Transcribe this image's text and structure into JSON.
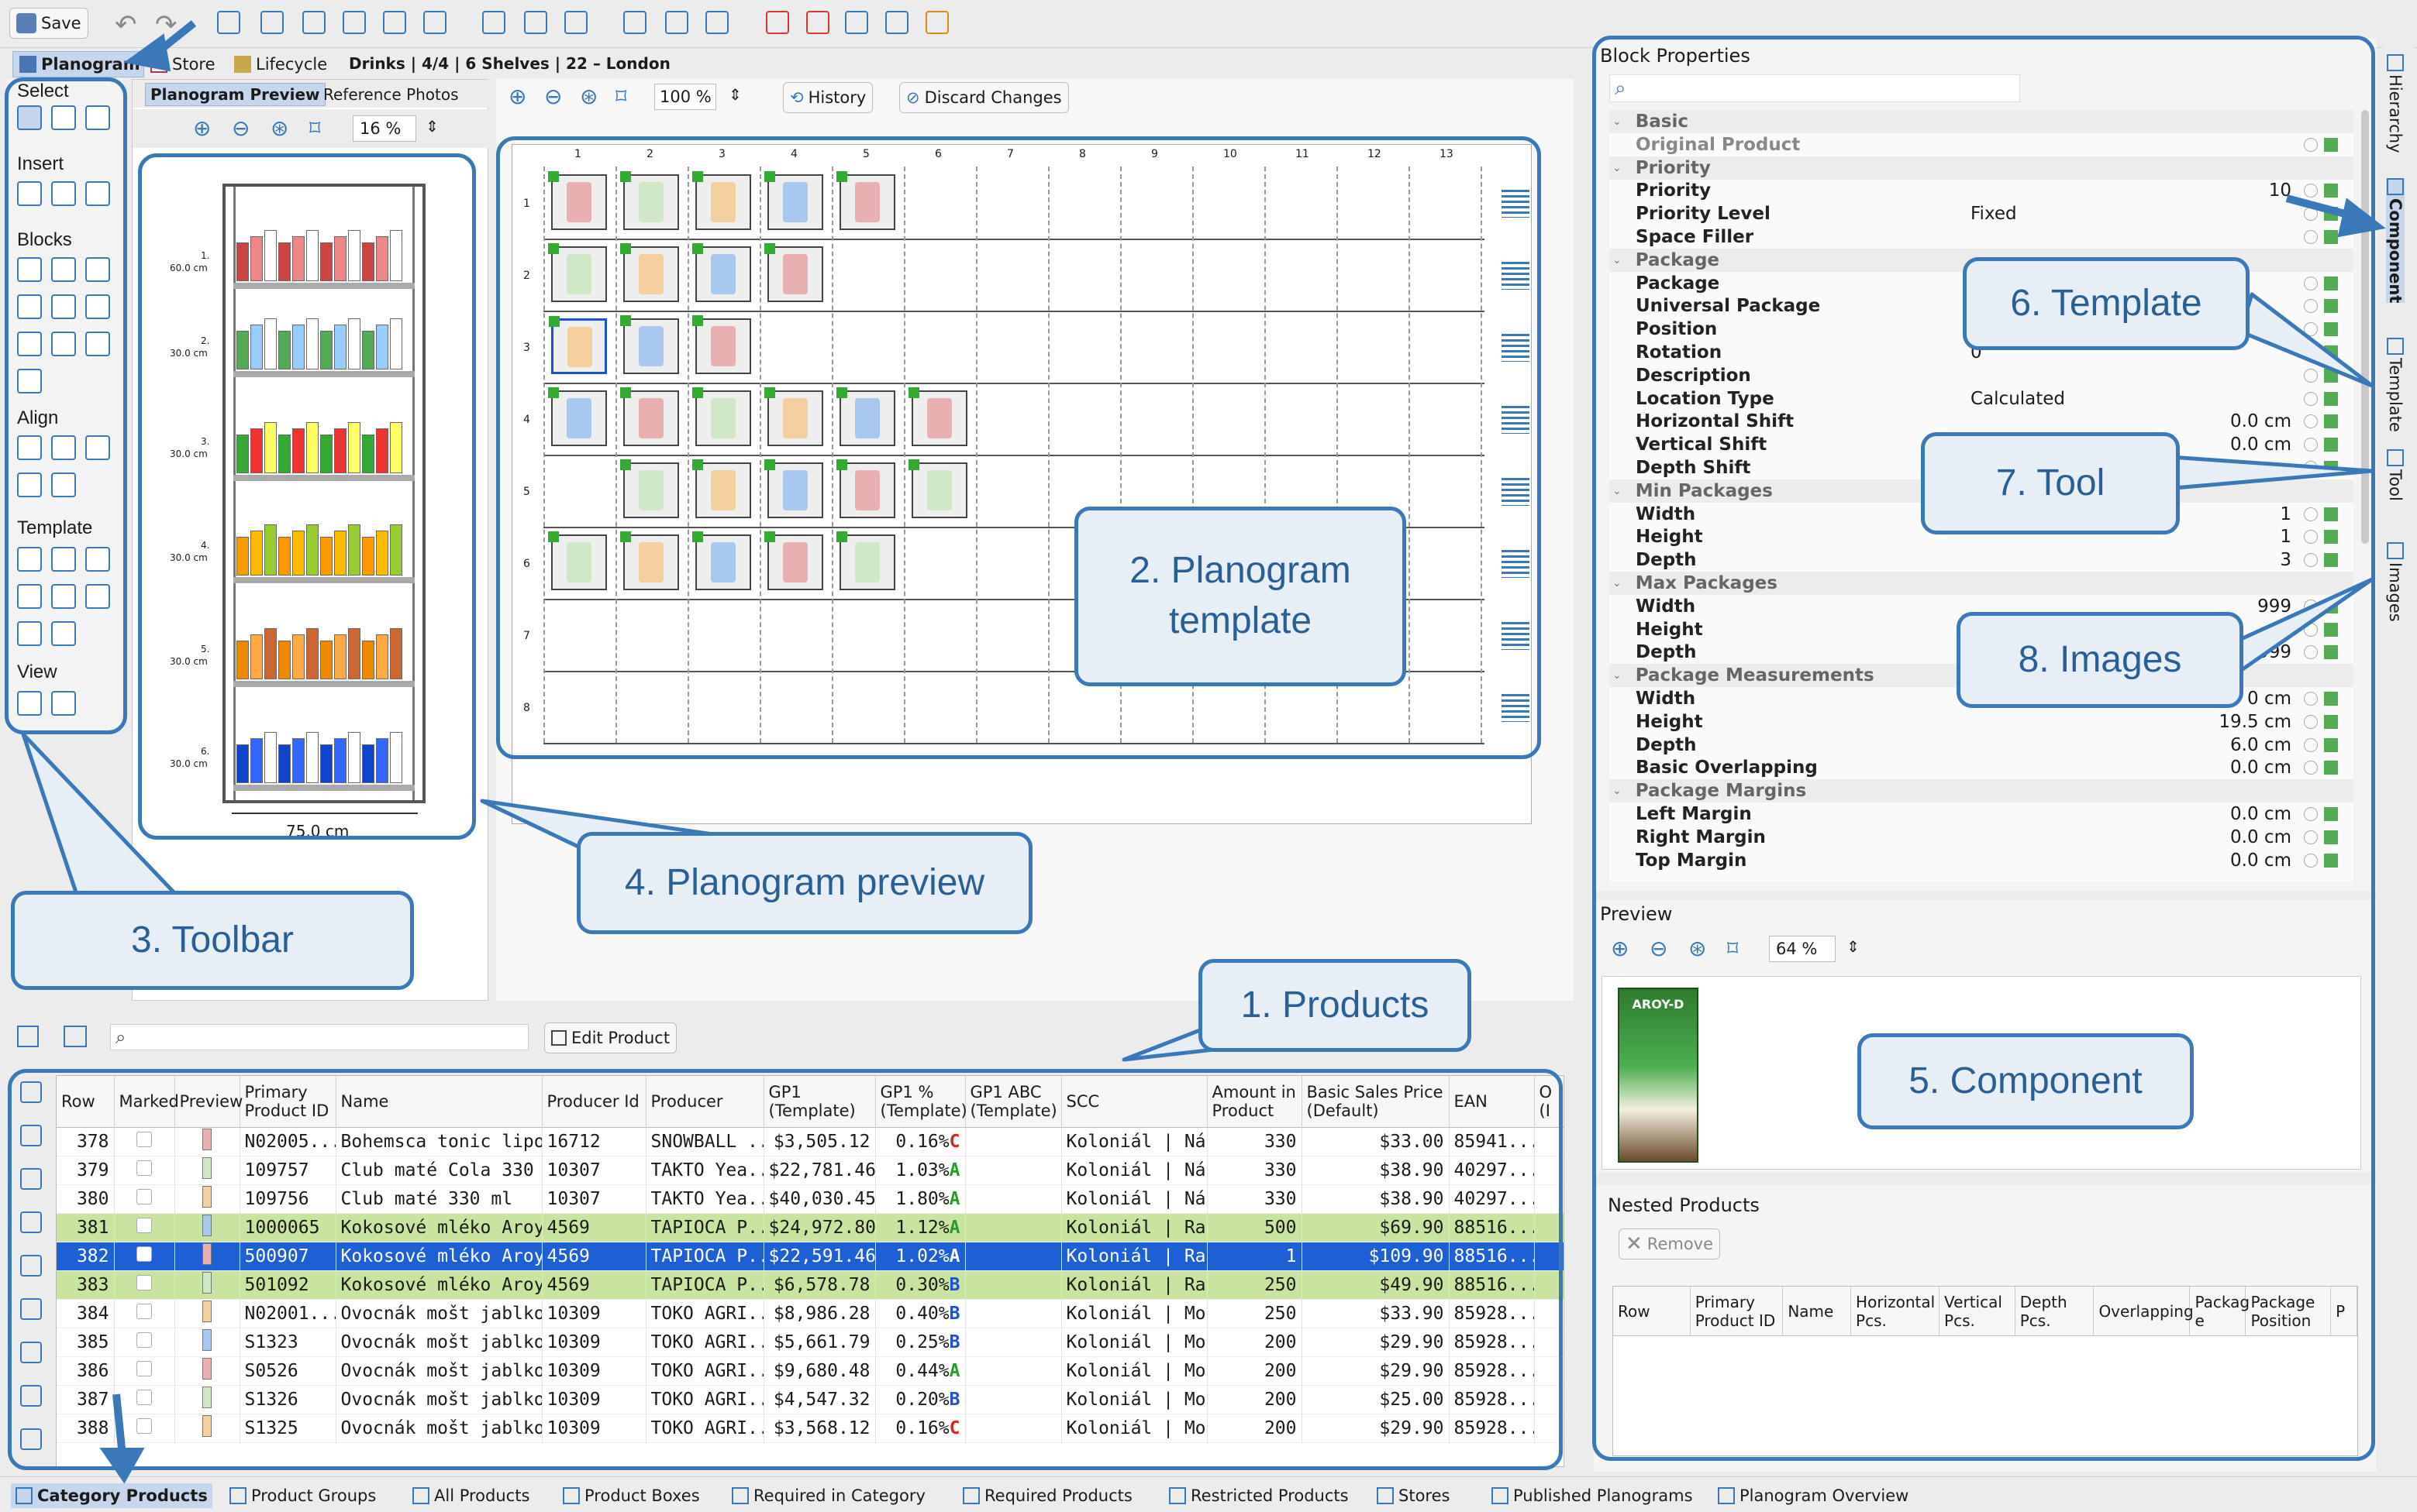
{
  "toolbar": {
    "save_label": "Save"
  },
  "tabs": {
    "planogram": "Planogram",
    "store": "Store",
    "lifecycle": "Lifecycle",
    "breadcrumb": "Drinks | 4/4 | 6 Shelves | 22 – London"
  },
  "left_toolbar": {
    "select": "Select",
    "insert": "Insert",
    "blocks": "Blocks",
    "align": "Align",
    "template": "Template",
    "view": "View"
  },
  "preview_panel": {
    "tab_active": "Planogram Preview",
    "tab_other": "Reference Photos",
    "zoom": "16 %",
    "width_label": "75.0 cm",
    "shelf_labels": [
      {
        "n": "1.",
        "h": "60.0 cm"
      },
      {
        "n": "2.",
        "h": "30.0 cm"
      },
      {
        "n": "3.",
        "h": "30.0 cm"
      },
      {
        "n": "4.",
        "h": "30.0 cm"
      },
      {
        "n": "5.",
        "h": "30.0 cm"
      },
      {
        "n": "6.",
        "h": "30.0 cm"
      }
    ]
  },
  "template_panel": {
    "zoom": "100 %",
    "history": "History",
    "discard": "Discard Changes",
    "col_numbers": [
      "1",
      "2",
      "3",
      "4",
      "5",
      "6",
      "7",
      "8",
      "9",
      "10",
      "11",
      "12",
      "13"
    ],
    "row_numbers": [
      "1",
      "2",
      "3",
      "4",
      "5",
      "6",
      "7",
      "8"
    ]
  },
  "products_panel": {
    "edit_product": "Edit Product",
    "columns": [
      "Row",
      "Marked",
      "Preview",
      "Primary Product ID",
      "Name",
      "Producer Id",
      "Producer",
      "GP1 (Template)",
      "GP1 % (Template)",
      "GP1 ABC (Template)",
      "SCC",
      "Amount in Product",
      "Basic Sales Price (Default)",
      "EAN",
      "O (I"
    ],
    "sort_indicator": "1",
    "rows": [
      {
        "row": "378",
        "id": "N02005...",
        "name": "Bohemsca tonic lipový...",
        "pid": "16712",
        "producer": "SNOWBALL ...",
        "gp1": "$3,505.12",
        "gp1p": "0.16%",
        "abc": "C",
        "scc": "Koloniál | Náp...",
        "amount": "330",
        "price": "$33.00",
        "ean": "85941...",
        "style": "normal"
      },
      {
        "row": "379",
        "id": "109757",
        "name": "Club maté Cola 330 ml",
        "pid": "10307",
        "producer": "TAKTO Yea...",
        "gp1": "$22,781.46",
        "gp1p": "1.03%",
        "abc": "A",
        "scc": "Koloniál | Náp...",
        "amount": "330",
        "price": "$38.90",
        "ean": "40297...",
        "style": "normal"
      },
      {
        "row": "380",
        "id": "109756",
        "name": "Club maté 330 ml",
        "pid": "10307",
        "producer": "TAKTO Yea...",
        "gp1": "$40,030.45",
        "gp1p": "1.80%",
        "abc": "A",
        "scc": "Koloniál | Náp...",
        "amount": "330",
        "price": "$38.90",
        "ean": "40297...",
        "style": "normal"
      },
      {
        "row": "381",
        "id": "1000065",
        "name": "Kokosové mléko Aroy...",
        "pid": "4569",
        "producer": "TAPIOCA P...",
        "gp1": "$24,972.80",
        "gp1p": "1.12%",
        "abc": "A",
        "scc": "Koloniál | Raci...",
        "amount": "500",
        "price": "$69.90",
        "ean": "88516...",
        "style": "green"
      },
      {
        "row": "382",
        "id": "500907",
        "name": "Kokosové mléko Aroy...",
        "pid": "4569",
        "producer": "TAPIOCA P...",
        "gp1": "$22,591.46",
        "gp1p": "1.02%",
        "abc": "A",
        "scc": "Koloniál | Raci...",
        "amount": "1",
        "price": "$109.90",
        "ean": "88516...",
        "style": "selected"
      },
      {
        "row": "383",
        "id": "501092",
        "name": "Kokosové mléko Aroy...",
        "pid": "4569",
        "producer": "TAPIOCA P...",
        "gp1": "$6,578.78",
        "gp1p": "0.30%",
        "abc": "B",
        "scc": "Koloniál | Raci...",
        "amount": "250",
        "price": "$49.90",
        "ean": "88516...",
        "style": "green"
      },
      {
        "row": "384",
        "id": "N02001...",
        "name": "Ovocnák mošt jablko ...",
        "pid": "10309",
        "producer": "TOKO AGRI...",
        "gp1": "$8,986.28",
        "gp1p": "0.40%",
        "abc": "B",
        "scc": "Koloniál | Moš...",
        "amount": "250",
        "price": "$33.90",
        "ean": "85928...",
        "style": "normal"
      },
      {
        "row": "385",
        "id": "S1323",
        "name": "Ovocnák mošt jablko...",
        "pid": "10309",
        "producer": "TOKO AGRI...",
        "gp1": "$5,661.79",
        "gp1p": "0.25%",
        "abc": "B",
        "scc": "Koloniál | Moš...",
        "amount": "200",
        "price": "$29.90",
        "ean": "85928...",
        "style": "normal"
      },
      {
        "row": "386",
        "id": "S0526",
        "name": "Ovocnák mošt jablko...",
        "pid": "10309",
        "producer": "TOKO AGRI...",
        "gp1": "$9,680.48",
        "gp1p": "0.44%",
        "abc": "A",
        "scc": "Koloniál | Moš...",
        "amount": "200",
        "price": "$29.90",
        "ean": "85928...",
        "style": "normal"
      },
      {
        "row": "387",
        "id": "S1326",
        "name": "Ovocnák mošt jablko...",
        "pid": "10309",
        "producer": "TOKO AGRI...",
        "gp1": "$4,547.32",
        "gp1p": "0.20%",
        "abc": "B",
        "scc": "Koloniál | Moš...",
        "amount": "200",
        "price": "$25.00",
        "ean": "85928...",
        "style": "normal"
      },
      {
        "row": "388",
        "id": "S1325",
        "name": "Ovocnák mošt jablko...",
        "pid": "10309",
        "producer": "TOKO AGRI...",
        "gp1": "$3,568.12",
        "gp1p": "0.16%",
        "abc": "C",
        "scc": "Koloniál | Moš...",
        "amount": "200",
        "price": "$29.90",
        "ean": "85928...",
        "style": "normal"
      }
    ]
  },
  "block_properties": {
    "title": "Block Properties",
    "rows": [
      {
        "kind": "group",
        "name": "Basic"
      },
      {
        "kind": "prop",
        "name": "Original Product",
        "muted": true,
        "value": ""
      },
      {
        "kind": "group",
        "name": "Priority"
      },
      {
        "kind": "prop",
        "name": "Priority",
        "value": "10",
        "align": "right"
      },
      {
        "kind": "prop",
        "name": "Priority Level",
        "value": "Fixed"
      },
      {
        "kind": "prop",
        "name": "Space Filler",
        "value": ""
      },
      {
        "kind": "group",
        "name": "Package"
      },
      {
        "kind": "prop",
        "name": "Package",
        "value": ""
      },
      {
        "kind": "prop",
        "name": "Universal Package",
        "value": ""
      },
      {
        "kind": "prop",
        "name": "Position",
        "value": ""
      },
      {
        "kind": "prop",
        "name": "Rotation",
        "value": "0"
      },
      {
        "kind": "prop",
        "name": "Description",
        "value": ""
      },
      {
        "kind": "prop",
        "name": "Location Type",
        "value": "Calculated"
      },
      {
        "kind": "prop",
        "name": "Horizontal Shift",
        "value": "0.0 cm",
        "align": "right"
      },
      {
        "kind": "prop",
        "name": "Vertical Shift",
        "value": "0.0 cm",
        "align": "right"
      },
      {
        "kind": "prop",
        "name": "Depth Shift",
        "value": ""
      },
      {
        "kind": "group",
        "name": "Min Packages"
      },
      {
        "kind": "prop",
        "name": "Width",
        "value": "1",
        "align": "right"
      },
      {
        "kind": "prop",
        "name": "Height",
        "value": "1",
        "align": "right"
      },
      {
        "kind": "prop",
        "name": "Depth",
        "value": "3",
        "align": "right"
      },
      {
        "kind": "group",
        "name": "Max Packages"
      },
      {
        "kind": "prop",
        "name": "Width",
        "value": "999",
        "align": "right"
      },
      {
        "kind": "prop",
        "name": "Height",
        "value": "",
        "align": "right"
      },
      {
        "kind": "prop",
        "name": "Depth",
        "value": "999",
        "align": "right"
      },
      {
        "kind": "group",
        "name": "Package Measurements"
      },
      {
        "kind": "prop",
        "name": "Width",
        "value": "0 cm",
        "align": "right"
      },
      {
        "kind": "prop",
        "name": "Height",
        "value": "19.5 cm",
        "align": "right"
      },
      {
        "kind": "prop",
        "name": "Depth",
        "value": "6.0 cm",
        "align": "right"
      },
      {
        "kind": "prop",
        "name": "Basic Overlapping",
        "value": "0.0 cm",
        "align": "right"
      },
      {
        "kind": "group",
        "name": "Package Margins"
      },
      {
        "kind": "prop",
        "name": "Left Margin",
        "value": "0.0 cm",
        "align": "right"
      },
      {
        "kind": "prop",
        "name": "Right Margin",
        "value": "0.0 cm",
        "align": "right"
      },
      {
        "kind": "prop",
        "name": "Top Margin",
        "value": "0.0 cm",
        "align": "right"
      }
    ],
    "preview_label": "Preview",
    "preview_zoom": "64 %",
    "product_brand": "AROY-D",
    "nested_title": "Nested Products",
    "remove_label": "Remove",
    "nested_columns": [
      "Row",
      "Primary Product ID",
      "Name",
      "Horizontal Pcs.",
      "Vertical Pcs.",
      "Depth Pcs.",
      "Overlapping",
      "Packag e",
      "Package Position",
      "P"
    ]
  },
  "side_tabs": [
    "Hierarchy",
    "Component",
    "Template",
    "Tool",
    "Images"
  ],
  "bottom_tabs": [
    "Category Products",
    "Product Groups",
    "All Products",
    "Product Boxes",
    "Required in Category",
    "Required Products",
    "Restricted Products",
    "Stores",
    "Published Planograms",
    "Planogram Overview"
  ],
  "callouts": {
    "products": "1. Products",
    "template": "2. Planogram template",
    "toolbar": "3. Toolbar",
    "preview": "4. Planogram preview",
    "component": "5. Component",
    "template6": "6. Template",
    "tool": "7. Tool",
    "images": "8. Images"
  },
  "colors": {
    "accent": "#3a78b8",
    "selection": "#1f5fd6",
    "highlight_green": "#c9e3a0",
    "abc_a": "#2a9a2a",
    "abc_b": "#1f4fd6",
    "abc_c": "#d22"
  }
}
